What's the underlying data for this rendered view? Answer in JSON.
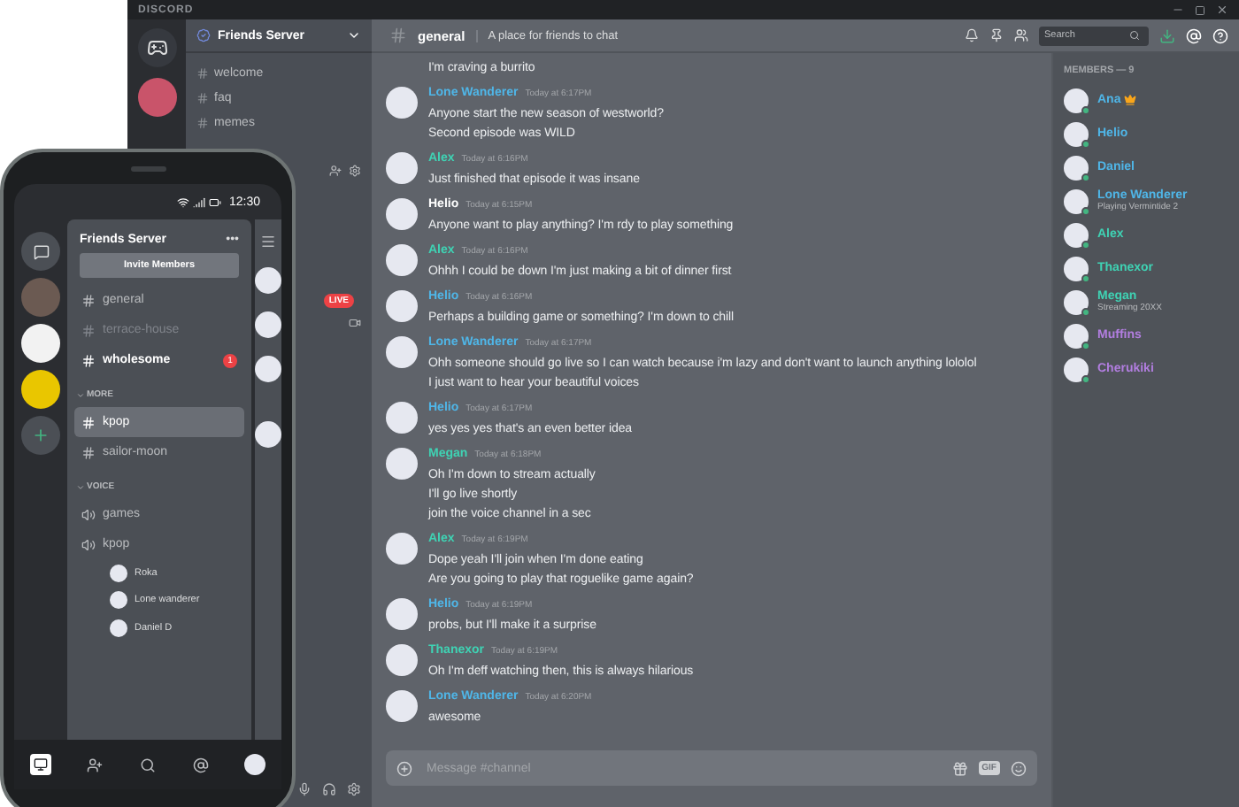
{
  "window": {
    "title": "DISCORD"
  },
  "server": {
    "name": "Friends Server"
  },
  "channels": [
    {
      "name": "welcome"
    },
    {
      "name": "faq"
    },
    {
      "name": "memes"
    }
  ],
  "live_badge": "LIVE",
  "chat": {
    "channel": "general",
    "topic": "A place for friends to chat",
    "search": {
      "placeholder": "Search"
    },
    "messages": [
      {
        "kind": "continuation",
        "lines": [
          "I'm craving a burrito"
        ]
      },
      {
        "kind": "message",
        "author": "Lone Wanderer",
        "color": "#4fb6e8",
        "time": "Today at 6:17PM",
        "lines": [
          "Anyone start the new season of westworld?",
          "Second episode was WILD"
        ]
      },
      {
        "kind": "message",
        "author": "Alex",
        "color": "#3fd3b4",
        "time": "Today at 6:16PM",
        "lines": [
          "Just finished that episode it was insane"
        ]
      },
      {
        "kind": "message",
        "author": "Helio",
        "color": "#ffffff",
        "time": "Today at 6:15PM",
        "lines": [
          "Anyone want to play anything? I'm rdy to play something"
        ]
      },
      {
        "kind": "message",
        "author": "Alex",
        "color": "#3fd3b4",
        "time": "Today at 6:16PM",
        "lines": [
          "Ohhh I could be down I'm just making a bit of dinner first"
        ]
      },
      {
        "kind": "message",
        "author": "Helio",
        "color": "#4fb6e8",
        "time": "Today at 6:16PM",
        "lines": [
          "Perhaps a building game or something? I'm down to chill"
        ]
      },
      {
        "kind": "message",
        "author": "Lone Wanderer",
        "color": "#4fb6e8",
        "time": "Today at 6:17PM",
        "lines": [
          "Ohh someone should go live so I can watch because i'm lazy and don't want to launch anything lololol",
          "I just want to hear your beautiful voices"
        ]
      },
      {
        "kind": "message",
        "author": "Helio",
        "color": "#4fb6e8",
        "time": "Today at 6:17PM",
        "lines": [
          "yes yes yes that's an even better idea"
        ]
      },
      {
        "kind": "message",
        "author": "Megan",
        "color": "#3fd3b4",
        "time": "Today at 6:18PM",
        "lines": [
          "Oh I'm down to stream actually",
          "I'll go live shortly",
          "join the voice channel in a sec"
        ]
      },
      {
        "kind": "message",
        "author": "Alex",
        "color": "#3fd3b4",
        "time": "Today at 6:19PM",
        "lines": [
          "Dope yeah I'll join when I'm done eating",
          "Are you going to play that roguelike game again?"
        ]
      },
      {
        "kind": "message",
        "author": "Helio",
        "color": "#4fb6e8",
        "time": "Today at 6:19PM",
        "lines": [
          "probs, but I'll make it a surprise"
        ]
      },
      {
        "kind": "message",
        "author": "Thanexor",
        "color": "#3fd3b4",
        "time": "Today at 6:19PM",
        "lines": [
          "Oh I'm deff watching then, this is always hilarious"
        ]
      },
      {
        "kind": "message",
        "author": "Lone Wanderer",
        "color": "#4fb6e8",
        "time": "Today at 6:20PM",
        "lines": [
          "awesome"
        ]
      }
    ],
    "input": {
      "placeholder": "Message #channel"
    },
    "gif": "GIF"
  },
  "members": {
    "title": "MEMBERS — 9",
    "list": [
      {
        "name": "Ana",
        "color": "#4fb6e8",
        "crown": true
      },
      {
        "name": "Helio",
        "color": "#4fb6e8",
        "crown": false
      },
      {
        "name": "Daniel",
        "color": "#4fb6e8",
        "crown": false
      },
      {
        "name": "Lone Wanderer",
        "color": "#4fb6e8",
        "crown": false,
        "activity": "Playing Vermintide 2"
      },
      {
        "name": "Alex",
        "color": "#3fd3b4",
        "crown": false
      },
      {
        "name": "Thanexor",
        "color": "#3fd3b4",
        "crown": false
      },
      {
        "name": "Megan",
        "color": "#3fd3b4",
        "crown": false,
        "activity": "Streaming 20XX"
      },
      {
        "name": "Muffins",
        "color": "#b27ee0",
        "crown": false
      },
      {
        "name": "Cherukiki",
        "color": "#b27ee0",
        "crown": false
      }
    ]
  },
  "phone": {
    "time": "12:30",
    "server_name": "Friends Server",
    "more": "•••",
    "invite": "Invite Members",
    "channels": [
      {
        "name": "general",
        "selected": false,
        "muted": false,
        "unread": false
      },
      {
        "name": "terrace-house",
        "selected": false,
        "muted": true,
        "unread": false
      },
      {
        "name": "wholesome",
        "selected": false,
        "muted": false,
        "unread": true,
        "badge": "1"
      }
    ],
    "categories": [
      {
        "name": "MORE",
        "kind": "text",
        "channels": [
          {
            "name": "kpop",
            "selected": true
          },
          {
            "name": "sailor-moon",
            "selected": false
          }
        ]
      },
      {
        "name": "VOICE",
        "kind": "voice",
        "channels": [
          {
            "name": "games",
            "selected": false
          },
          {
            "name": "kpop",
            "selected": false,
            "children": [
              {
                "name": "Roka"
              },
              {
                "name": "Lone wanderer"
              },
              {
                "name": "Daniel D"
              }
            ]
          }
        ]
      }
    ]
  }
}
